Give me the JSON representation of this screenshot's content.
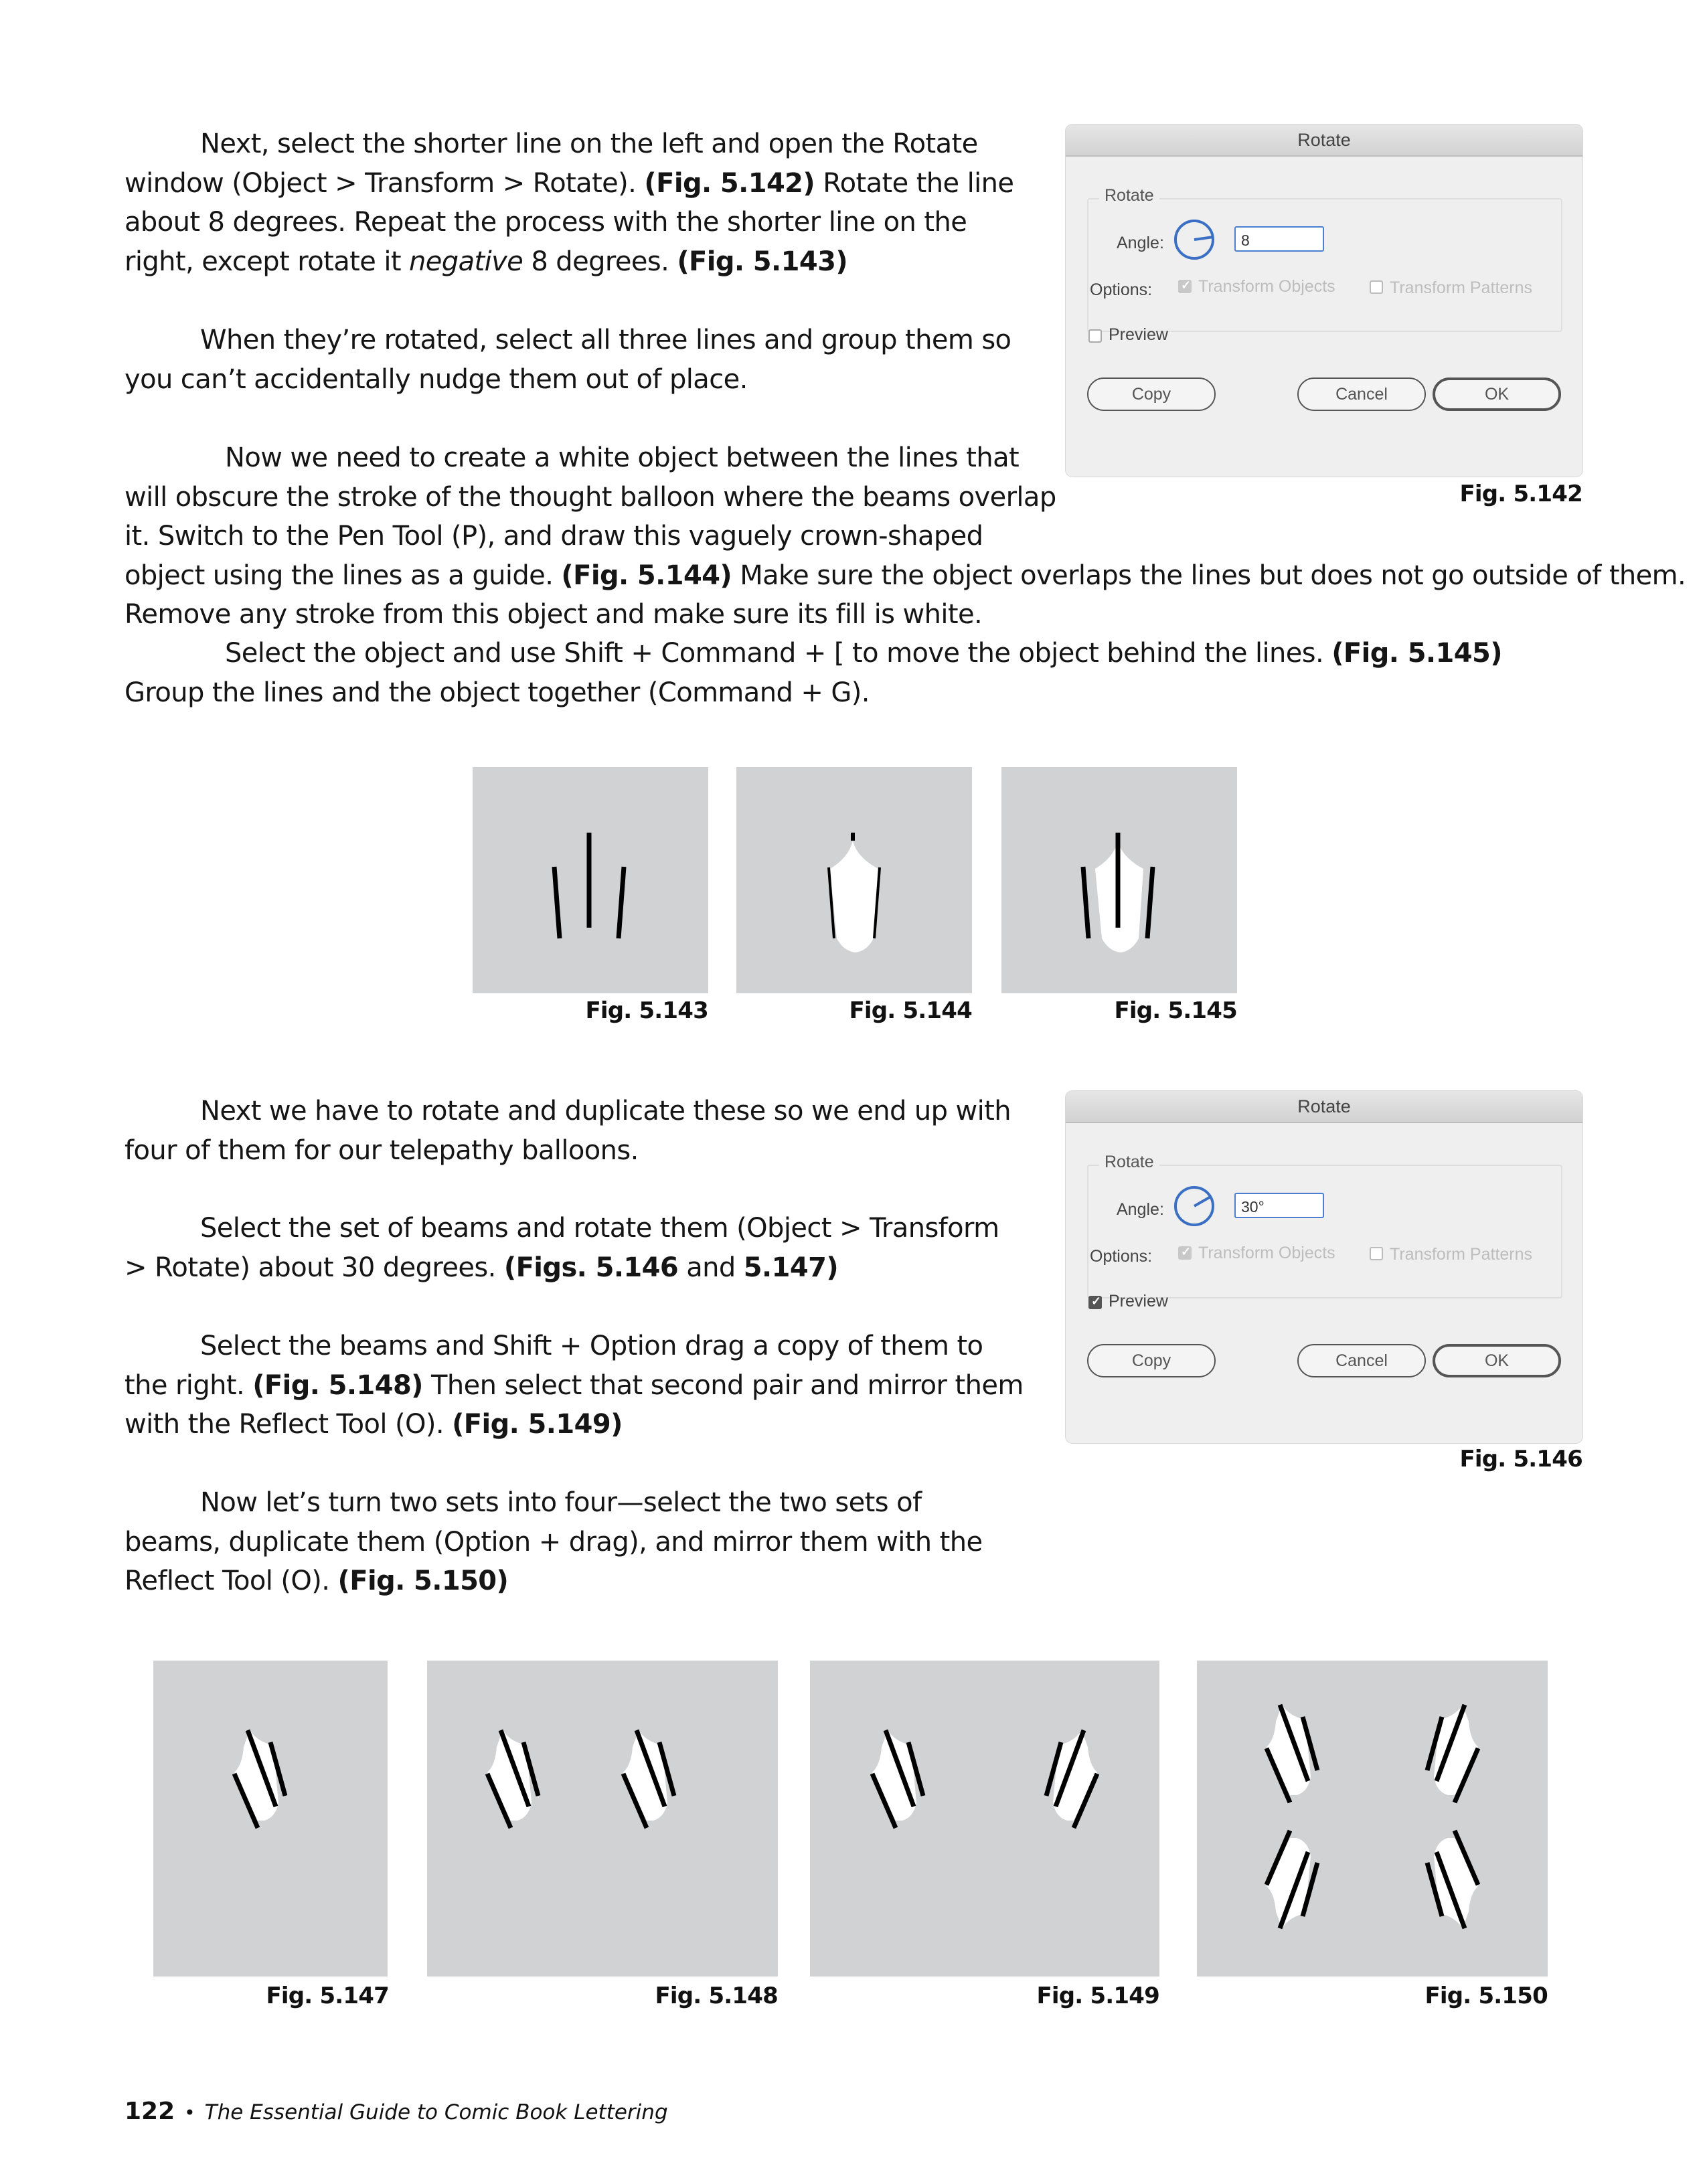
{
  "paragraphs": {
    "p1": {
      "before": "Next, select the shorter line on the left and open the Rotate window (Object > Transform > Rotate).",
      "ref1": "(Fig. 5.142)",
      "mid": " Rotate the line about 8 degrees. Repeat the process with the shorter line on the right, except rotate it ",
      "em": "negative",
      "after": " 8 degrees. ",
      "ref2": "(Fig. 5.143)"
    },
    "p2": {
      "text": "When they’re rotated, select all three lines and group them so you can’t accidentally nudge them out of place."
    },
    "p3": {
      "line1": "Now we need to create a white object between the lines that",
      "line2": "will obscure the stroke of the thought balloon where the beams overlap",
      "line3": "it. Switch to the Pen Tool (P), and draw this vaguely crown-shaped",
      "line4_before": "object using the lines as a guide. ",
      "line4_ref": "(Fig. 5.144)",
      "line4_after": " Make sure the object overlaps the lines but does not go outside of them.",
      "line5": "Remove any stroke from this object and make sure its fill is white."
    },
    "p4": {
      "before": "Select the object and use Shift + Command + [ to move the object behind the lines. ",
      "ref": "(Fig. 5.145)",
      "after": " Group the lines and the object together (Command + G)."
    },
    "p5": {
      "text": "Next we have to rotate and duplicate these so we end up with four of them for our telepathy balloons."
    },
    "p6": {
      "before": "Select the set of beams and rotate them (Object > Transform > Rotate) about 30 degrees. ",
      "ref_a": "(Figs. 5.146",
      "and": " and ",
      "ref_b": "5.147)"
    },
    "p7": {
      "before": "Select the beams and Shift + Option drag a copy of them to the right. ",
      "ref1": "(Fig. 5.148)",
      "mid": " Then select that second pair and mirror them with the Reflect Tool (O). ",
      "ref2": "(Fig. 5.149)"
    },
    "p8": {
      "before": "Now let’s turn two sets into four—select the two sets of beams, duplicate them (Option + drag), and mirror them with the Reflect Tool (O). ",
      "ref": "(Fig. 5.150)"
    }
  },
  "dialogs": [
    {
      "title": "Rotate",
      "group_label": "Rotate",
      "angle_label": "Angle:",
      "angle_value": "8",
      "angle_degrees": 8,
      "options_label": "Options:",
      "transform_objects": {
        "label": "Transform Objects",
        "checked": true,
        "disabled": true
      },
      "transform_patterns": {
        "label": "Transform Patterns",
        "checked": false,
        "disabled": true
      },
      "preview": {
        "label": "Preview",
        "checked": false
      },
      "buttons": {
        "copy": "Copy",
        "cancel": "Cancel",
        "ok": "OK"
      },
      "caption": "Fig. 5.142"
    },
    {
      "title": "Rotate",
      "group_label": "Rotate",
      "angle_label": "Angle:",
      "angle_value": "30°",
      "angle_degrees": 30,
      "options_label": "Options:",
      "transform_objects": {
        "label": "Transform Objects",
        "checked": true,
        "disabled": true
      },
      "transform_patterns": {
        "label": "Transform Patterns",
        "checked": false,
        "disabled": true
      },
      "preview": {
        "label": "Preview",
        "checked": true
      },
      "buttons": {
        "copy": "Copy",
        "cancel": "Cancel",
        "ok": "OK"
      },
      "caption": "Fig. 5.146"
    }
  ],
  "figures": {
    "f143": "Fig. 5.143",
    "f144": "Fig. 5.144",
    "f145": "Fig. 5.145",
    "f147": "Fig. 5.147",
    "f148": "Fig. 5.148",
    "f149": "Fig. 5.149",
    "f150": "Fig. 5.150"
  },
  "colors": {
    "figure_bg": "#d1d2d4",
    "dialog_bg": "#efefef",
    "dial_blue": "#3a6fc4"
  },
  "footer": {
    "page_number": "122",
    "separator": "•",
    "book_title": "The Essential Guide to Comic Book Lettering"
  }
}
